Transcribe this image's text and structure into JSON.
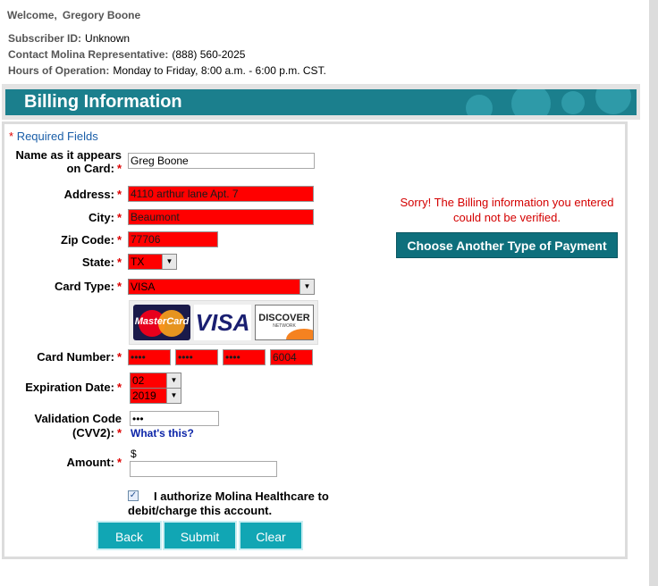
{
  "header": {
    "welcome": "Welcome,",
    "user_name": "Gregory Boone",
    "subscriber_label": "Subscriber ID:",
    "subscriber_value": "Unknown",
    "contact_label": "Contact Molina Representative:",
    "contact_value": "(888) 560-2025",
    "hours_label": "Hours of Operation:",
    "hours_value": "Monday to Friday, 8:00 a.m. - 6:00 p.m. CST."
  },
  "banner": {
    "title": "Billing Information"
  },
  "form": {
    "required_star": "*",
    "required_note": "Required Fields",
    "star": "*",
    "name_label_line1": "Name as it appears",
    "name_label_line2": "on Card:",
    "name_value": "Greg Boone",
    "address_label": "Address:",
    "address_value": "4110 arthur lane Apt. 7",
    "city_label": "City:",
    "city_value": "Beaumont",
    "zip_label": "Zip Code:",
    "zip_value": "77706",
    "state_label": "State:",
    "state_value": "TX",
    "card_type_label": "Card Type:",
    "card_type_value": "VISA",
    "card_logos": {
      "mastercard": "MasterCard",
      "visa": "VISA",
      "discover": "DISCOVER",
      "discover_sub": "NETWORK"
    },
    "card_number_label": "Card Number:",
    "card_number": [
      "••••",
      "••••",
      "••••",
      "6004"
    ],
    "expiration_label": "Expiration Date:",
    "exp_month": "02",
    "exp_year": "2019",
    "cvv_label_line1": "Validation Code",
    "cvv_label_line2": "(CVV2):",
    "cvv_value": "•••",
    "whats_this": "What's this?",
    "amount_label": "Amount:",
    "amount_currency": "$",
    "amount_value": "",
    "authorize_text": "I authorize Molina Healthcare to debit/charge this account.",
    "authorize_checked": true
  },
  "buttons": {
    "back": "Back",
    "submit": "Submit",
    "clear": "Clear"
  },
  "error": {
    "message": "Sorry! The Billing information you entered could not be verified.",
    "choose_another": "Choose Another Type of Payment"
  },
  "colors": {
    "banner": "#1b7f8d",
    "error_field": "#ff0000",
    "button": "#11a6b4",
    "link": "#0b24a8"
  }
}
